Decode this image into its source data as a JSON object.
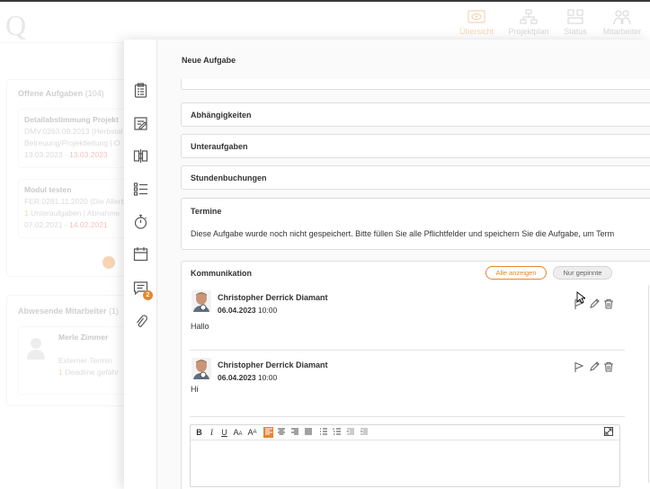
{
  "background": {
    "logo": "Q",
    "nav": [
      {
        "label": "Übersicht",
        "icon": "eye-icon",
        "active": true
      },
      {
        "label": "Projektplan",
        "icon": "hierarchy-icon"
      },
      {
        "label": "Status",
        "icon": "status-icon"
      },
      {
        "label": "Mitarbeiter",
        "icon": "people-icon"
      }
    ],
    "open_tasks": {
      "heading": "Offene Aufgaben",
      "count": "(104)",
      "cards": [
        {
          "title": "Detailabstimmung Projekt",
          "line1": "DMV.0263.09.2013 (Herbstal",
          "line2": "Betreuung/Projektleitung | O",
          "date_start": "13.03.2023",
          "sep": " - ",
          "date_end": "13.03.2023"
        },
        {
          "title": "Modul testen",
          "line1": "FER.0281.11.2020 (Die Allerb",
          "line2_count": "1",
          "line2": " Unteraufgaben | Abnahme",
          "date_start": "07.02.2021",
          "sep": " - ",
          "date_end": "14.02.2021"
        }
      ]
    },
    "absent": {
      "heading": "Abwesende Mitarbeiter",
      "count": "(1)",
      "card": {
        "name": "Merle Zimmer",
        "line1": "Externer Termin",
        "line2_count": "1",
        "line2": " Deadline gefähr"
      }
    }
  },
  "panel": {
    "title": "Neue Aufgabe",
    "side_icons": [
      "clipboard-icon",
      "edit-note-icon",
      "compare-icon",
      "checklist-icon",
      "stopwatch-icon",
      "calendar-icon",
      "comment-icon",
      "paperclip-icon"
    ],
    "comment_badge": "2",
    "sections": {
      "dependencies": "Abhängigkeiten",
      "subtasks": "Unteraufgaben",
      "hours": "Stundenbuchungen",
      "dates": "Termine",
      "dates_message": "Diese Aufgabe wurde noch nicht gespeichert. Bitte füllen Sie alle Pflichtfelder und speichern Sie die Aufgabe, um Term"
    },
    "communication": {
      "heading": "Kommunikation",
      "show_all": "Alle anzeigen",
      "only_pinned": "Nur gepinnte",
      "comments": [
        {
          "author": "Christopher Derrick Diamant",
          "date": "06.04.2023",
          "time": "10:00",
          "text": "Hallo"
        },
        {
          "author": "Christopher Derrick Diamant",
          "date": "06.04.2023",
          "time": "10:00",
          "text": "Hi"
        }
      ]
    },
    "editor": {
      "bold": "B",
      "italic": "I",
      "underline": "U",
      "font_size": "A",
      "font_size_sub": "A"
    }
  },
  "colors": {
    "accent": "#e8862c",
    "danger": "#e04c4c"
  }
}
